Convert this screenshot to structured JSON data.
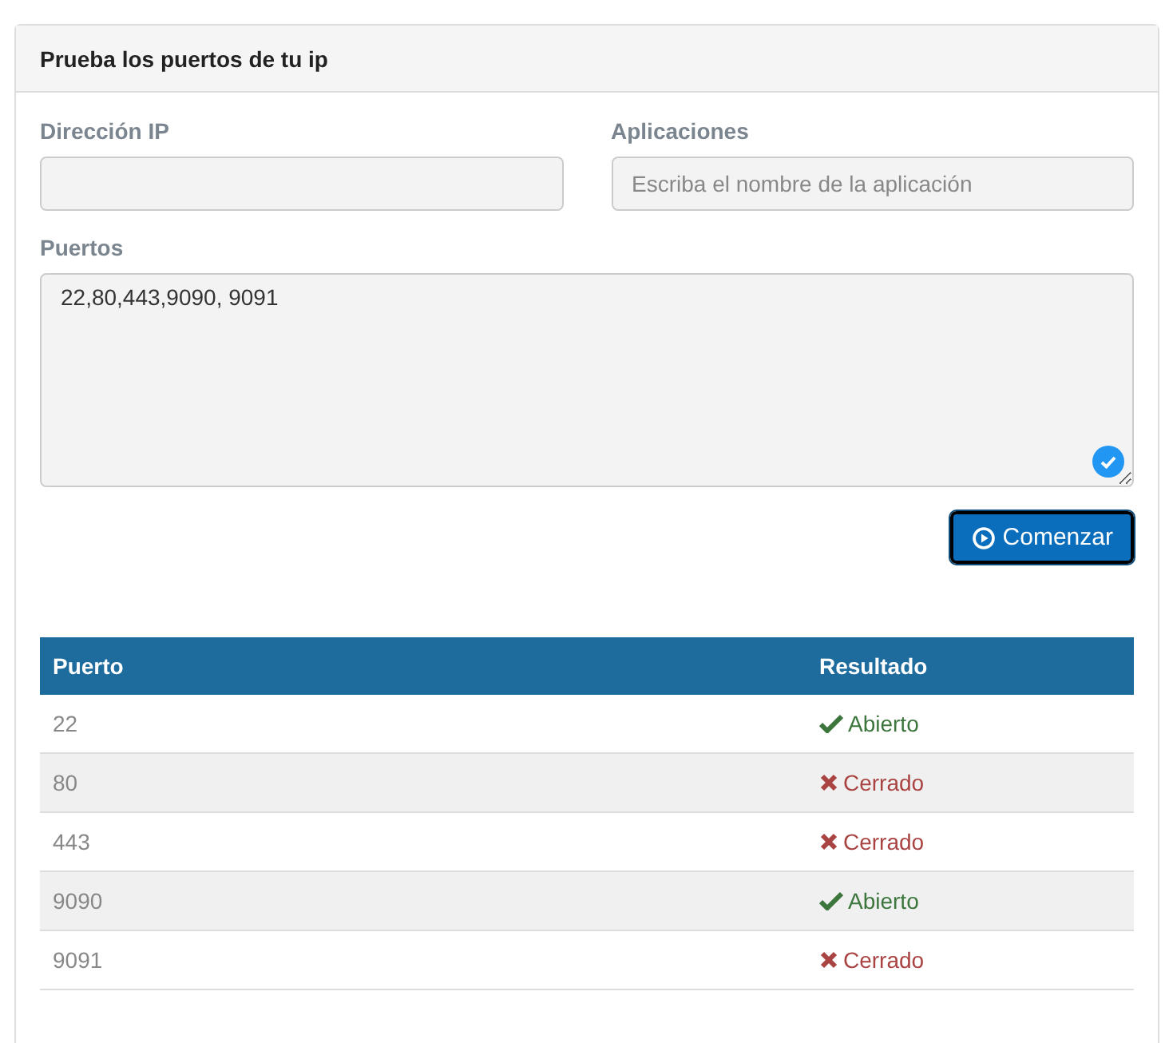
{
  "panel": {
    "title": "Prueba los puertos de tu ip"
  },
  "fields": {
    "ip": {
      "label": "Dirección IP"
    },
    "apps": {
      "label": "Aplicaciones",
      "placeholder": "Escriba el nombre de la aplicación"
    },
    "ports": {
      "label": "Puertos",
      "value": "22,80,443,9090, 9091",
      "valid": true
    }
  },
  "start_button": {
    "label": "Comenzar"
  },
  "table": {
    "columns": [
      "Puerto",
      "Resultado"
    ],
    "rows": [
      {
        "port": "22",
        "kind": "open",
        "result": "Abierto"
      },
      {
        "port": "80",
        "kind": "closed",
        "result": "Cerrado"
      },
      {
        "port": "443",
        "kind": "closed",
        "result": "Cerrado"
      },
      {
        "port": "9090",
        "kind": "open",
        "result": "Abierto"
      },
      {
        "port": "9091",
        "kind": "closed",
        "result": "Cerrado"
      }
    ]
  }
}
